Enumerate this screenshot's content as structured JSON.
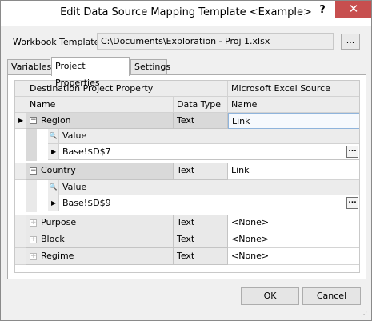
{
  "window": {
    "title": "Edit Data Source Mapping Template <Example>",
    "help_label": "?",
    "close_label": "✕"
  },
  "workbook": {
    "label": "Workbook Template:",
    "value": "C:\\Documents\\Exploration - Proj 1.xlsx",
    "browse_label": "..."
  },
  "tabs": [
    {
      "label": "Variables"
    },
    {
      "label": "Project Properties"
    },
    {
      "label": "Settings"
    }
  ],
  "active_tab": "Project Properties",
  "grid": {
    "group_headers": {
      "destination": "Destination Project Property",
      "source": "Microsoft Excel Source"
    },
    "columns": {
      "name": "Name",
      "data_type": "Data Type",
      "source_name": "Name"
    },
    "rows": [
      {
        "name": "Region",
        "data_type": "Text",
        "source": "Link",
        "expanded": true,
        "selected": true,
        "detail": {
          "header": "Value",
          "value": "Base!$D$7",
          "button": "..."
        }
      },
      {
        "name": "Country",
        "data_type": "Text",
        "source": "Link",
        "expanded": true,
        "detail": {
          "header": "Value",
          "value": "Base!$D$9",
          "button": "..."
        }
      },
      {
        "name": "Purpose",
        "data_type": "Text",
        "source": "<None>",
        "expanded": false
      },
      {
        "name": "Block",
        "data_type": "Text",
        "source": "<None>",
        "expanded": false
      },
      {
        "name": "Regime",
        "data_type": "Text",
        "source": "<None>",
        "expanded": false
      }
    ]
  },
  "buttons": {
    "ok_label": "OK",
    "cancel_label": "Cancel"
  }
}
